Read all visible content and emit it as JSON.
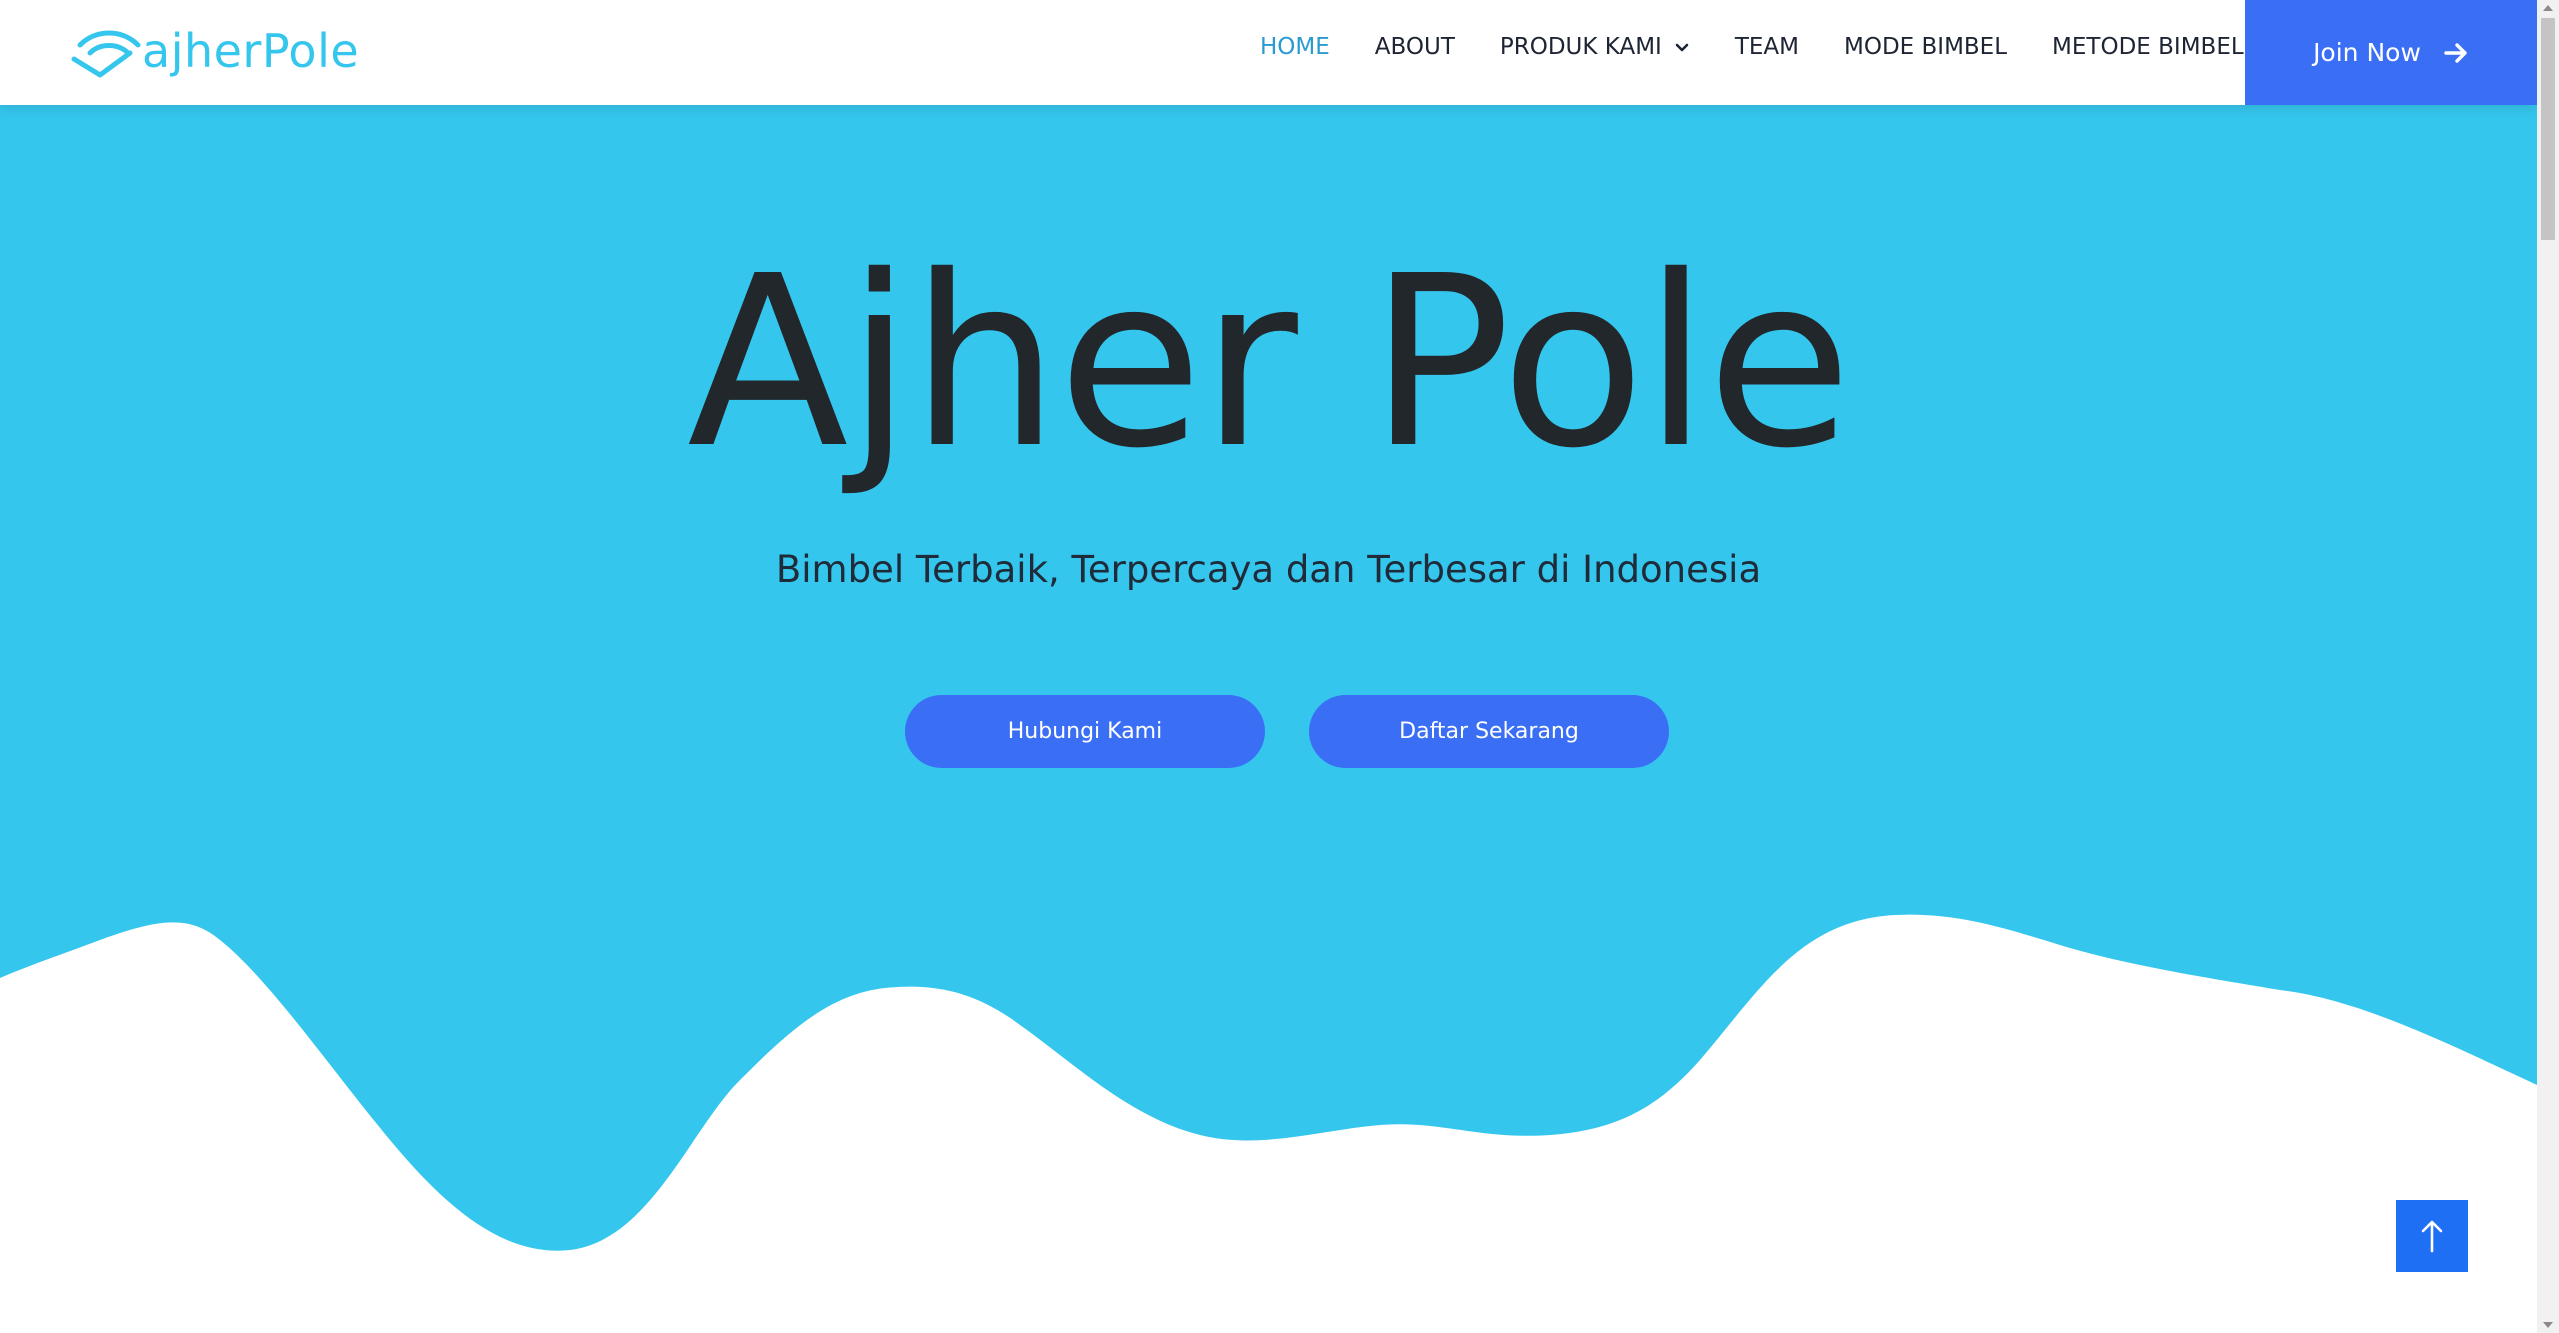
{
  "brand": {
    "logo_text": "ajherPole",
    "logo_icon": "wifi-swoosh-logo",
    "accent_color": "#35c6ed"
  },
  "nav": {
    "items": [
      {
        "label": "HOME",
        "active": true
      },
      {
        "label": "ABOUT",
        "active": false
      },
      {
        "label": "PRODUK KAMI",
        "active": false,
        "dropdown": true
      },
      {
        "label": "TEAM",
        "active": false
      },
      {
        "label": "MODE BIMBEL",
        "active": false
      },
      {
        "label": "METODE BIMBEL",
        "active": false
      }
    ],
    "join_label": "Join Now",
    "join_icon": "arrow-right-icon"
  },
  "hero": {
    "title": "Ajher Pole",
    "subtitle": "Bimbel Terbaik, Terpercaya dan Terbesar di Indonesia",
    "primary_button": "Hubungi Kami",
    "secondary_button": "Daftar Sekarang",
    "background_color": "#35c6ed"
  },
  "back_to_top": {
    "icon": "arrow-up-icon"
  },
  "colors": {
    "hero_bg": "#35c6ed",
    "button_blue": "#3a6ff5",
    "nav_active": "#2a9bd1",
    "text_dark": "#22272b"
  }
}
